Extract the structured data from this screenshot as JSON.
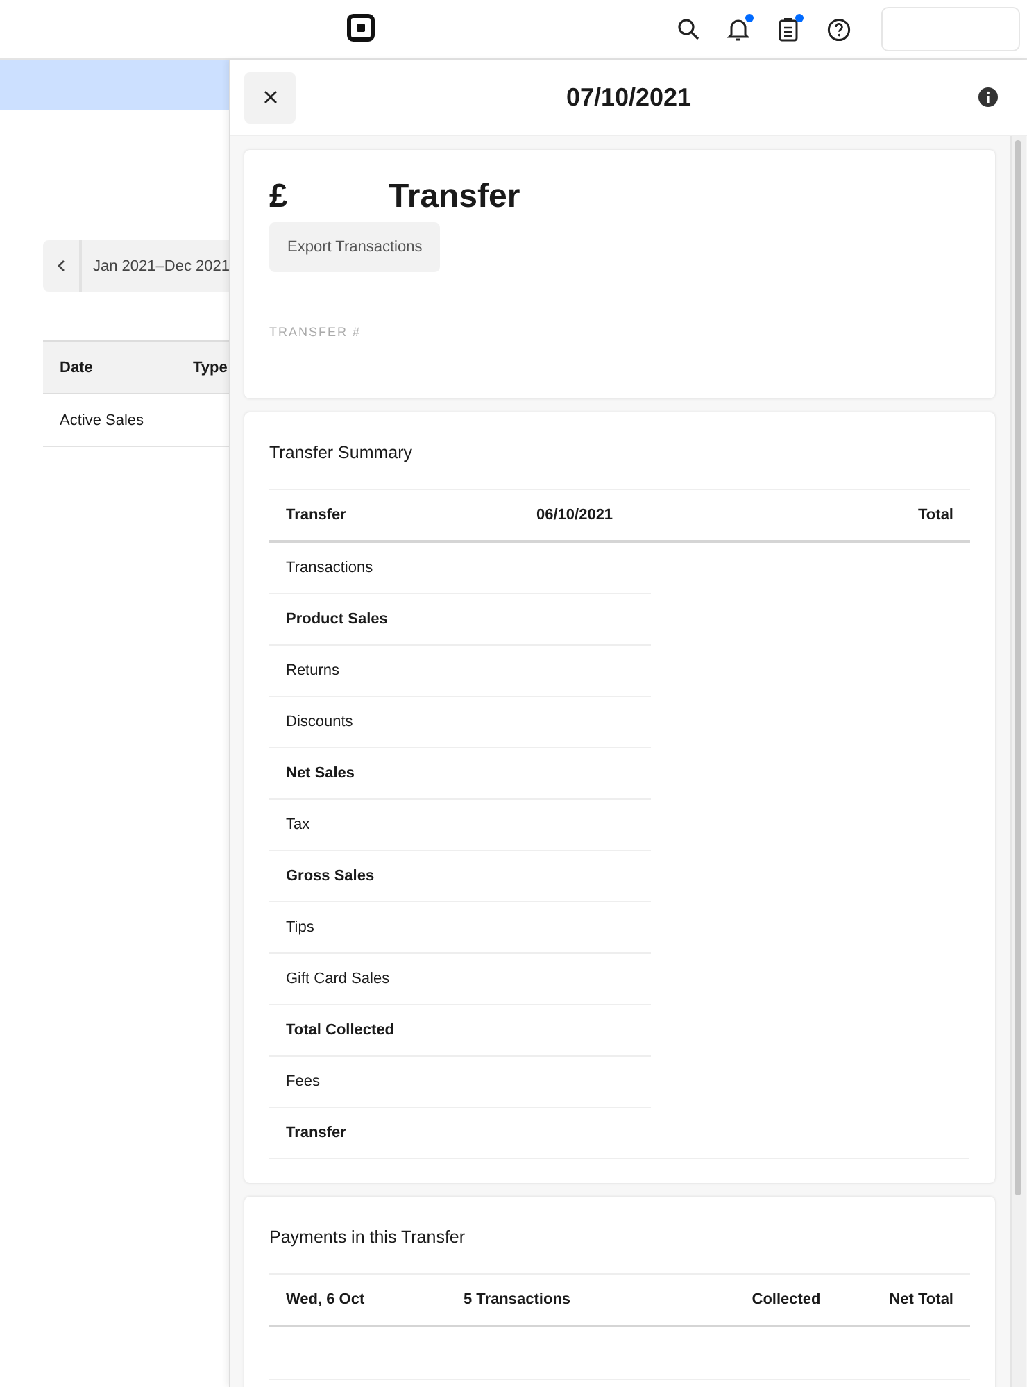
{
  "page": {
    "date_range": "Jan 2021–Dec 2021",
    "table": {
      "columns": [
        "Date",
        "Type"
      ],
      "rows": [
        {
          "cells": [
            "Active Sales"
          ]
        }
      ]
    }
  },
  "panel": {
    "title": "07/10/2021",
    "header_card": {
      "currency": "£",
      "title": "Transfer",
      "export_button": "Export Transactions",
      "transfer_label": "TRANSFER #"
    },
    "summary": {
      "title": "Transfer Summary",
      "columns": [
        "Transfer",
        "06/10/2021",
        "Total"
      ],
      "rows": [
        {
          "label": "Transactions",
          "bold": false
        },
        {
          "label": "Product Sales",
          "bold": true
        },
        {
          "label": "Returns",
          "bold": false
        },
        {
          "label": "Discounts",
          "bold": false
        },
        {
          "label": "Net Sales",
          "bold": true
        },
        {
          "label": "Tax",
          "bold": false
        },
        {
          "label": "Gross Sales",
          "bold": true
        },
        {
          "label": "Tips",
          "bold": false
        },
        {
          "label": "Gift Card Sales",
          "bold": false
        },
        {
          "label": "Total Collected",
          "bold": true
        },
        {
          "label": "Fees",
          "bold": false
        },
        {
          "label": "Transfer",
          "bold": true
        }
      ]
    },
    "payments": {
      "title": "Payments in this Transfer",
      "columns": [
        "Wed, 6 Oct",
        "5 Transactions",
        "Collected",
        "Net Total"
      ]
    }
  }
}
